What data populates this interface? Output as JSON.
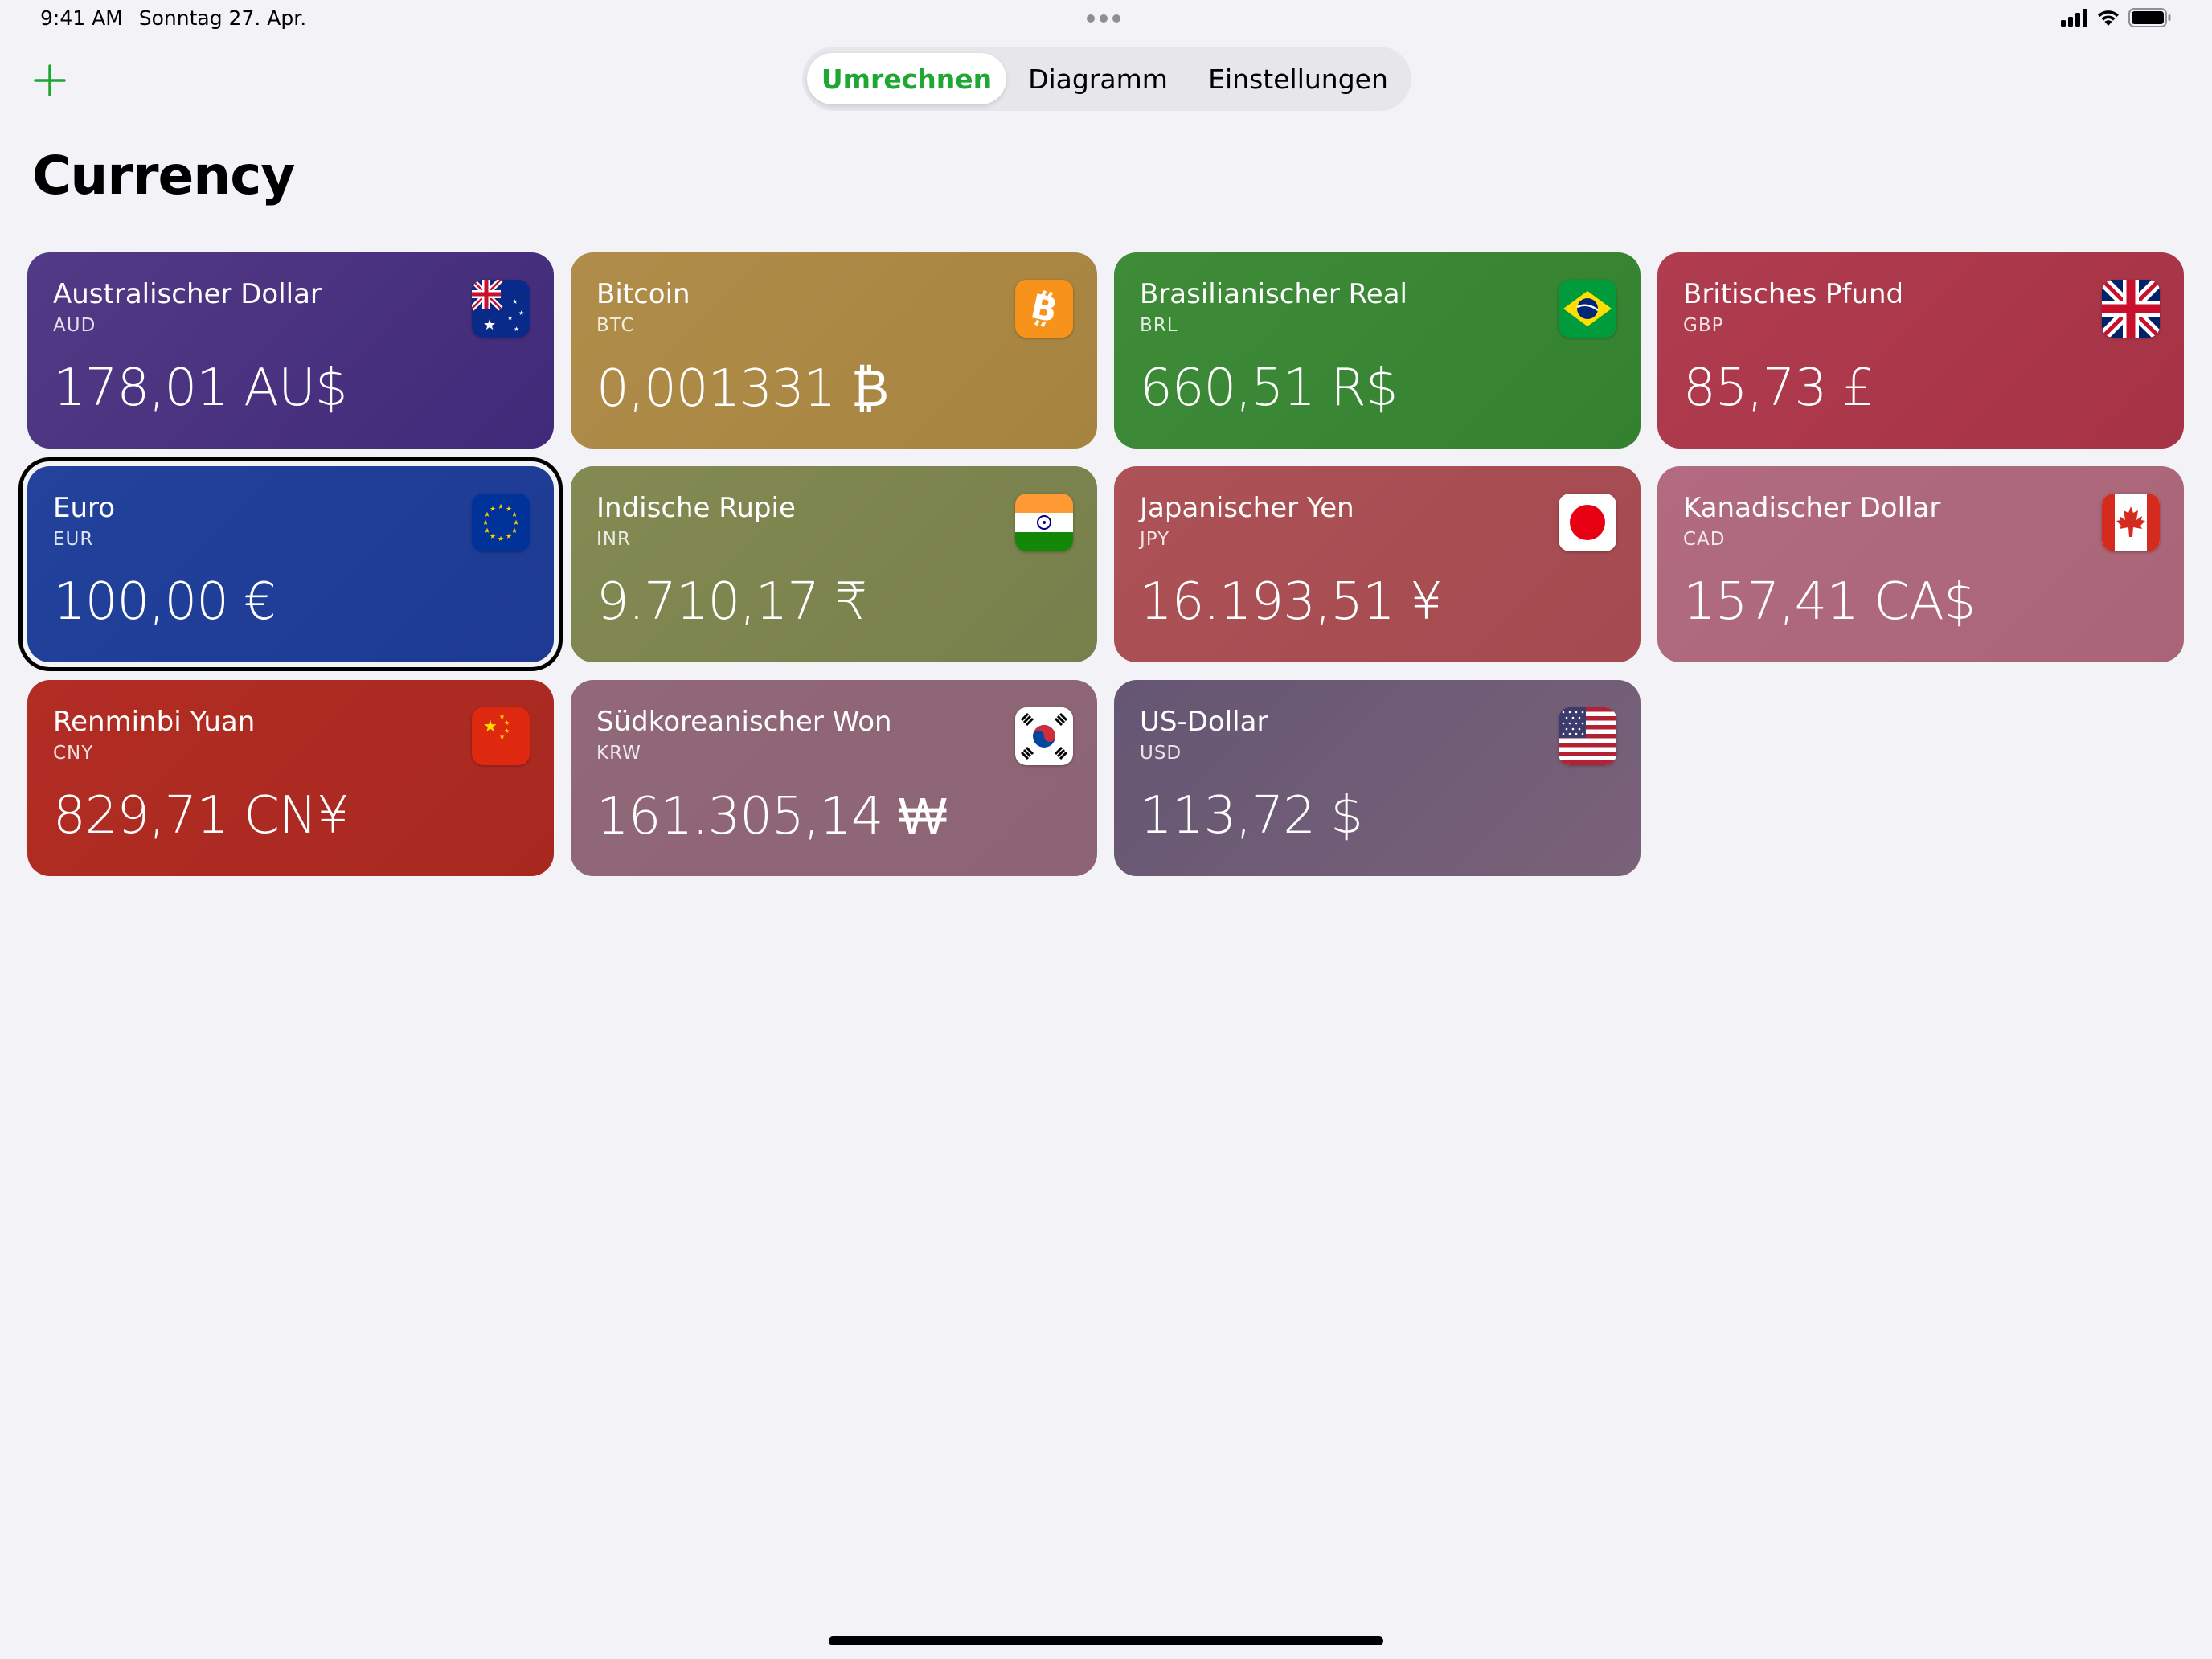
{
  "status_bar": {
    "time": "9:41 AM",
    "date": "Sonntag 27. Apr."
  },
  "toolbar": {
    "add_icon": "plus-icon",
    "tabs": [
      {
        "label": "Umrechnen",
        "active": true
      },
      {
        "label": "Diagramm",
        "active": false
      },
      {
        "label": "Einstellungen",
        "active": false
      }
    ]
  },
  "page": {
    "title": "Currency"
  },
  "colors": {
    "accent": "#1ea733",
    "background": "#f2f2f7"
  },
  "currencies": [
    {
      "name": "Australischer Dollar",
      "code": "AUD",
      "value": "178,01 AU$",
      "color": "#4a2f80",
      "flag": "australia-flag-icon"
    },
    {
      "name": "Bitcoin",
      "code": "BTC",
      "value": "0,001331 ₿",
      "color": "#a98a44",
      "flag": "bitcoin-icon"
    },
    {
      "name": "Brasilianischer Real",
      "code": "BRL",
      "value": "660,51 R$",
      "color": "#3a8a35",
      "flag": "brazil-flag-icon"
    },
    {
      "name": "Britisches Pfund",
      "code": "GBP",
      "value": "85,73 £",
      "color": "#ad3a4c",
      "flag": "uk-flag-icon"
    },
    {
      "name": "Euro",
      "code": "EUR",
      "value": "100,00 €",
      "color": "#213f99",
      "flag": "eu-flag-icon",
      "selected": true
    },
    {
      "name": "Indische Rupie",
      "code": "INR",
      "value": "9.710,17 ₹",
      "color": "#7d8550",
      "flag": "india-flag-icon"
    },
    {
      "name": "Japanischer Yen",
      "code": "JPY",
      "value": "16.193,51 ¥",
      "color": "#aa4f54",
      "flag": "japan-flag-icon"
    },
    {
      "name": "Kanadischer Dollar",
      "code": "CAD",
      "value": "157,41 CA$",
      "color": "#af6a7e",
      "flag": "canada-flag-icon"
    },
    {
      "name": "Renminbi Yuan",
      "code": "CNY",
      "value": "829,71 CN¥",
      "color": "#ad2a22",
      "flag": "china-flag-icon"
    },
    {
      "name": "Südkoreanischer Won",
      "code": "KRW",
      "value": "161.305,14 ₩",
      "color": "#8f6777",
      "flag": "korea-flag-icon"
    },
    {
      "name": "US-Dollar",
      "code": "USD",
      "value": "113,72 $",
      "color": "#6d5a78",
      "flag": "usa-flag-icon"
    }
  ]
}
